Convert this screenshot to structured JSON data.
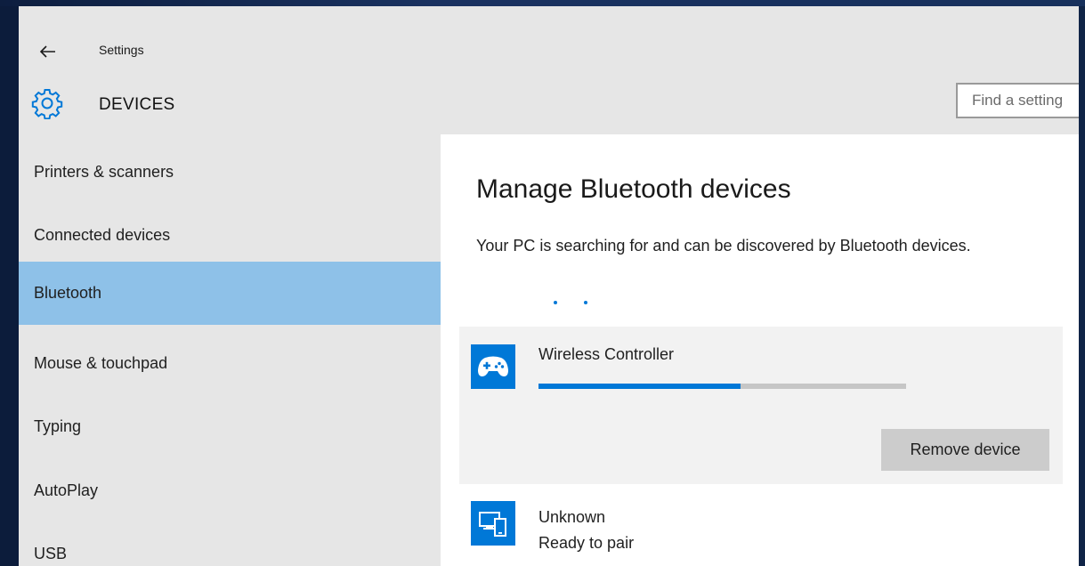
{
  "window": {
    "title": "Settings",
    "section": "DEVICES"
  },
  "search": {
    "placeholder": "Find a setting"
  },
  "sidebar": {
    "selected_index": 2,
    "items": [
      {
        "label": "Printers & scanners"
      },
      {
        "label": "Connected devices"
      },
      {
        "label": "Bluetooth"
      },
      {
        "label": "Mouse & touchpad"
      },
      {
        "label": "Typing"
      },
      {
        "label": "AutoPlay"
      },
      {
        "label": "USB"
      }
    ]
  },
  "main": {
    "title": "Manage Bluetooth devices",
    "description": "Your PC is searching for and can be discovered by Bluetooth devices.",
    "devices": [
      {
        "name": "Wireless Controller",
        "icon": "gamepad-icon",
        "progress": 0.55,
        "action_label": "Remove device"
      },
      {
        "name": "Unknown",
        "status": "Ready to pair",
        "icon": "display-phone-icon"
      }
    ]
  },
  "colors": {
    "accent": "#0078d7",
    "selected_nav": "#8ec1e8",
    "chrome": "#e6e6e6"
  }
}
